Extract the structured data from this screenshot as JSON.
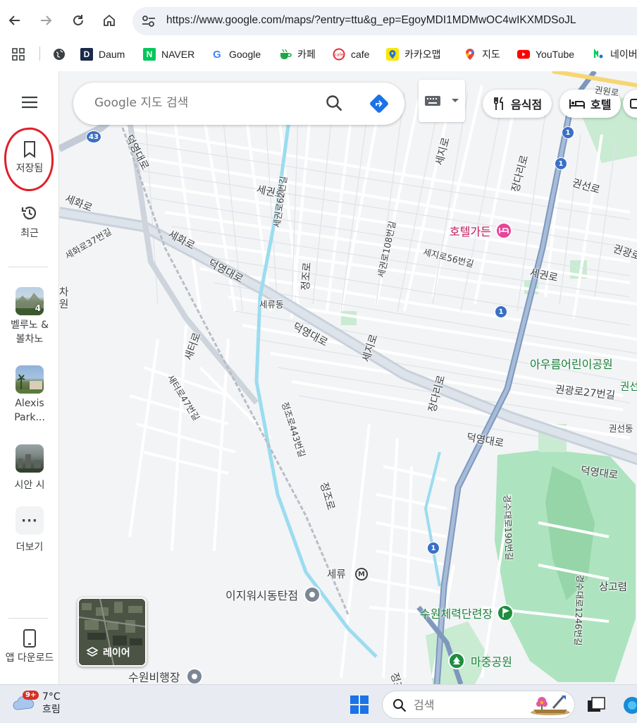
{
  "browser": {
    "url": "https://www.google.com/maps/?entry=ttu&g_ep=EgoyMDI1MDMwOC4wIKXMDSoJL",
    "bookmarks": [
      {
        "label": "Daum",
        "icon": "daum-icon"
      },
      {
        "label": "NAVER",
        "icon": "naver-icon"
      },
      {
        "label": "Google",
        "icon": "google-icon"
      },
      {
        "label": "카페",
        "icon": "cafe-cup-icon"
      },
      {
        "label": "cafe",
        "icon": "cafe-logo-icon"
      },
      {
        "label": "카카오맵",
        "icon": "kakaomap-icon"
      },
      {
        "label": "지도",
        "icon": "google-maps-icon"
      },
      {
        "label": "YouTube",
        "icon": "youtube-icon"
      },
      {
        "label": "네이버",
        "icon": "naver-map-icon"
      }
    ]
  },
  "sidebar": {
    "menu_icon": "menu-icon",
    "saved_label": "저장됨",
    "recent_label": "최근",
    "recents": [
      {
        "label": "벨루노 & 볼차노",
        "count": "4"
      },
      {
        "label": "Alexis Park...",
        "count": ""
      },
      {
        "label": "시안 시",
        "count": ""
      }
    ],
    "more_label": "더보기",
    "download_label": "앱 다운로드"
  },
  "map": {
    "search_placeholder": "Google 지도 검색",
    "chips": [
      {
        "label": "음식점",
        "icon": "restaurant-icon"
      },
      {
        "label": "호텔",
        "icon": "hotel-icon"
      }
    ],
    "layer_label": "레이어",
    "roads": [
      {
        "text": "덕영대로"
      },
      {
        "text": "세화로"
      },
      {
        "text": "세화로"
      },
      {
        "text": "세화로37번길"
      },
      {
        "text": "세권로"
      },
      {
        "text": "세권로62번길"
      },
      {
        "text": "세권로108번길"
      },
      {
        "text": "세지로"
      },
      {
        "text": "세지로56번길"
      },
      {
        "text": "세권로"
      },
      {
        "text": "세지로"
      },
      {
        "text": "장다리로"
      },
      {
        "text": "권선로"
      },
      {
        "text": "권광로"
      },
      {
        "text": "정조로"
      },
      {
        "text": "세류동"
      },
      {
        "text": "덕영대로"
      },
      {
        "text": "덕영대로"
      },
      {
        "text": "새터로"
      },
      {
        "text": "새터로47번길"
      },
      {
        "text": "정조로443번길"
      },
      {
        "text": "장다리로"
      },
      {
        "text": "덕영대로"
      },
      {
        "text": "덕영대로"
      },
      {
        "text": "권광로27번길"
      },
      {
        "text": "권선동"
      },
      {
        "text": "정조로"
      },
      {
        "text": "경수대로190번길"
      },
      {
        "text": "경수대로1246번길"
      },
      {
        "text": "세류"
      },
      {
        "text": "권원로"
      },
      {
        "text": "차원"
      },
      {
        "text": "상고렴"
      },
      {
        "text": "권선"
      },
      {
        "text": "정조"
      }
    ],
    "pois": [
      {
        "text": "호텔가든",
        "color": "#c2185b"
      },
      {
        "text": "아우름어린이공원",
        "color": "#188038"
      },
      {
        "text": "이지워시동탄점",
        "color": "#3c4043"
      },
      {
        "text": "수원체력단련장",
        "color": "#188038"
      },
      {
        "text": "마중공원",
        "color": "#188038"
      },
      {
        "text": "수원비행장",
        "color": "#3c4043"
      }
    ],
    "route_shields": [
      "43",
      "1",
      "1",
      "1",
      "1"
    ]
  },
  "taskbar": {
    "temperature": "7°C",
    "condition": "흐림",
    "badge": "9+",
    "search_placeholder": "검색"
  }
}
